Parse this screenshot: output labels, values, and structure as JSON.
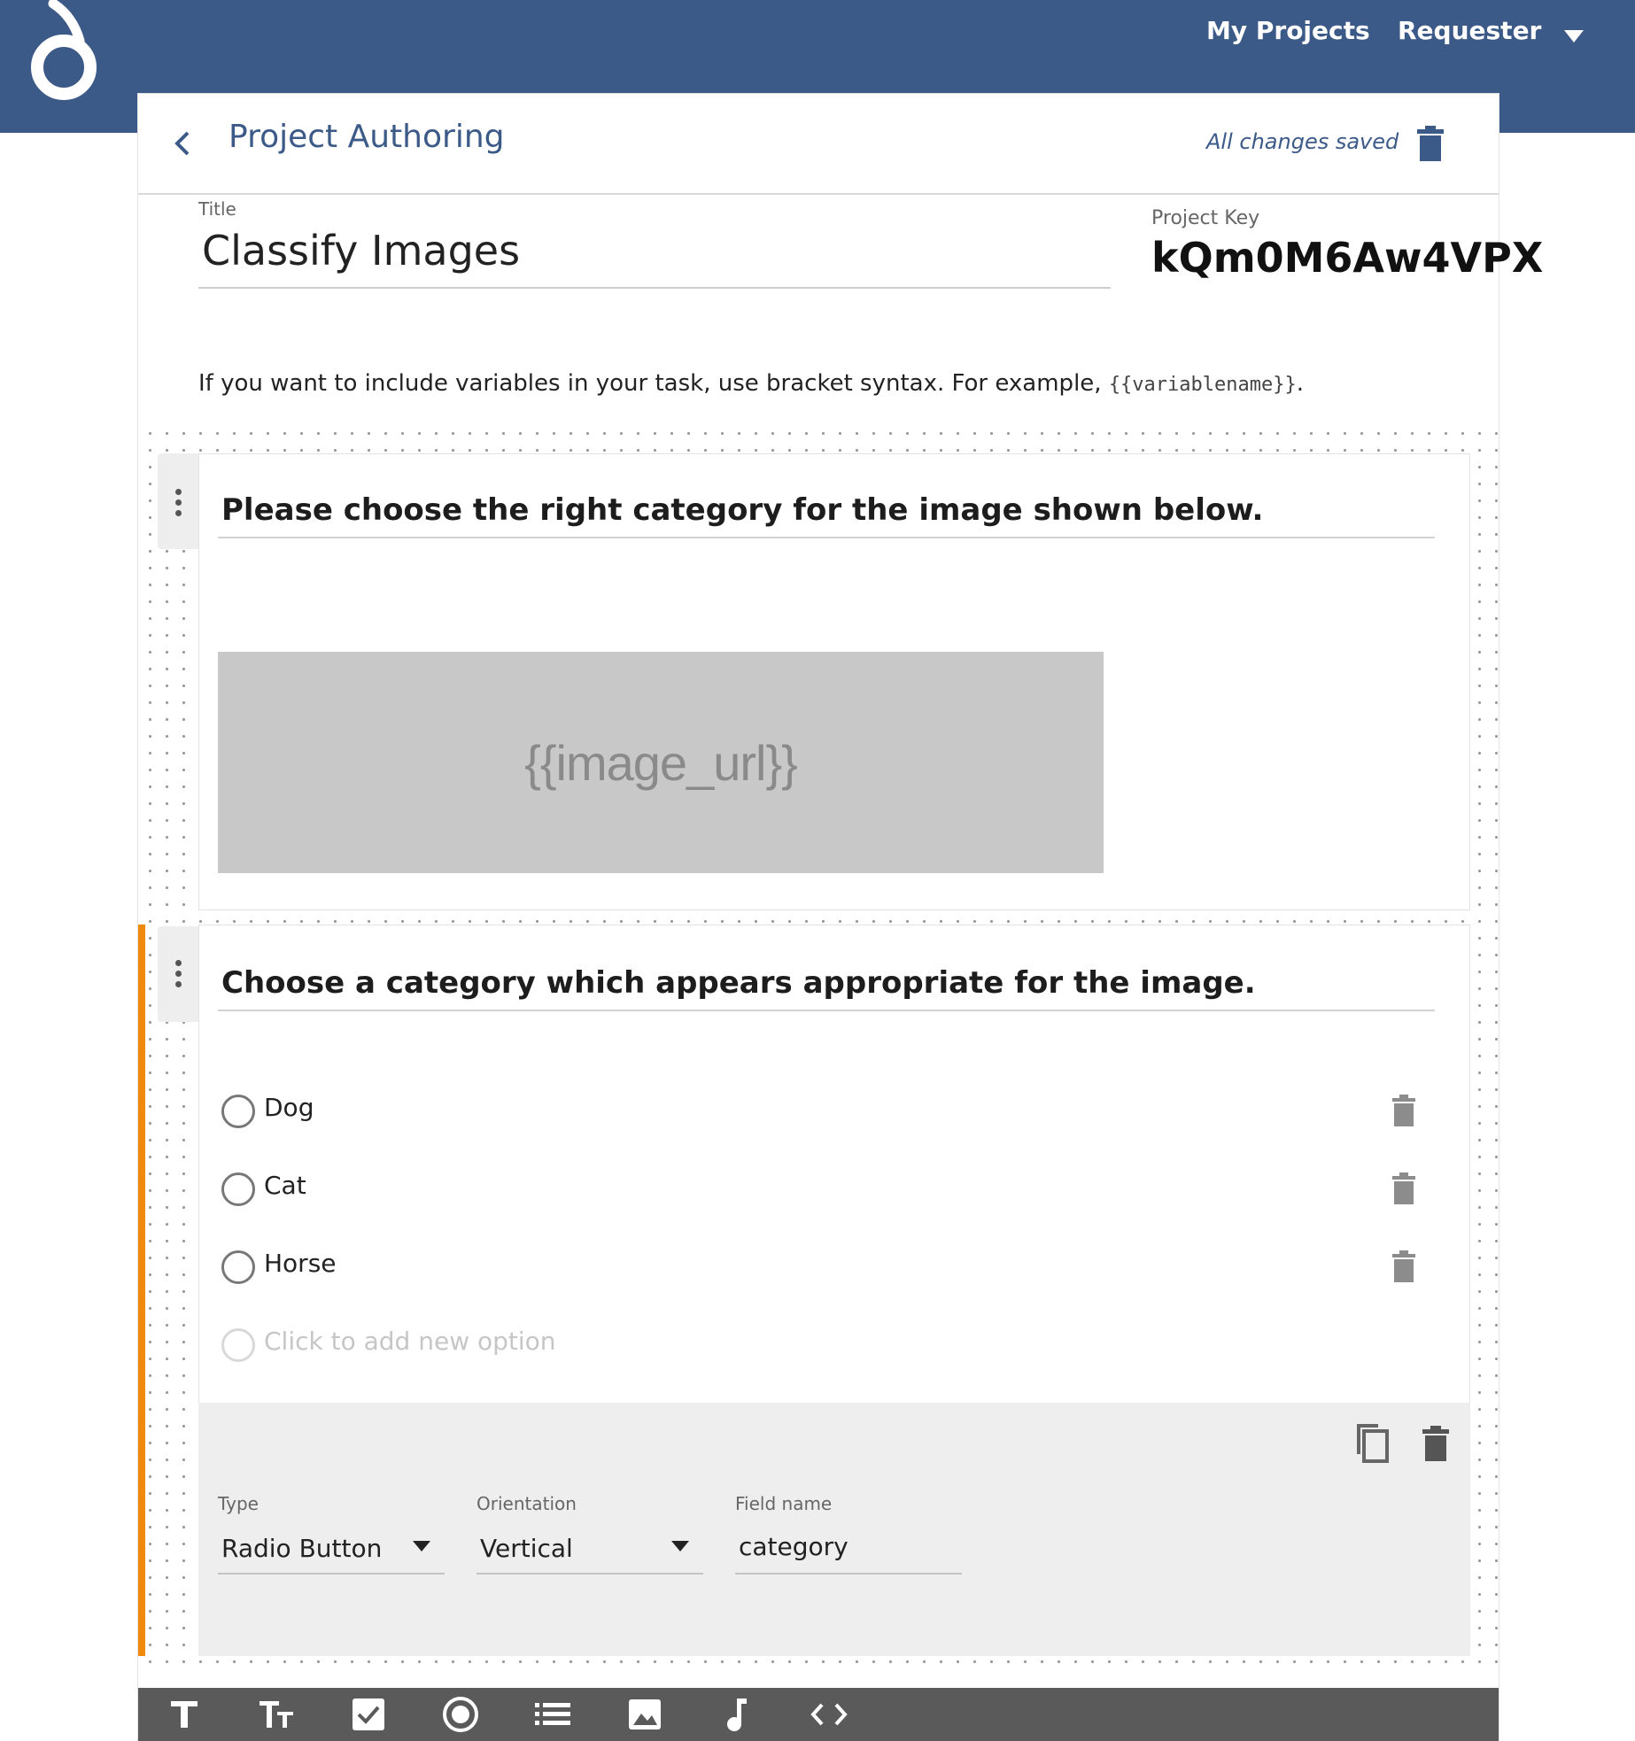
{
  "nav": {
    "links": [
      "My Projects",
      "Requester"
    ]
  },
  "header": {
    "title": "Project Authoring",
    "status": "All changes saved"
  },
  "project": {
    "title_label": "Title",
    "title_value": "Classify Images",
    "key_label": "Project Key",
    "key_value": "kQm0M6Aw4VPX"
  },
  "hint": {
    "text": "If you want to include variables in your task, use bracket syntax. For example, ",
    "code": "{{variablename}}",
    "suffix": "."
  },
  "blocks": [
    {
      "question": "Please choose the right category for the image shown below.",
      "image_placeholder": "{{image_url}}"
    },
    {
      "question": "Choose a category which appears appropriate for the image.",
      "options": [
        "Dog",
        "Cat",
        "Horse"
      ],
      "add_option_placeholder": "Click to add new option",
      "settings": {
        "type_label": "Type",
        "type_value": "Radio Button",
        "orientation_label": "Orientation",
        "orientation_value": "Vertical",
        "field_label": "Field name",
        "field_value": "category"
      }
    }
  ],
  "colors": {
    "brand": "#3c5a88",
    "accent": "#f08a0c",
    "toolbar": "#5a5a5a"
  },
  "toolbar_icons": [
    "text-icon",
    "text-size-icon",
    "checkbox-icon",
    "radio-icon",
    "list-icon",
    "image-icon",
    "audio-icon",
    "code-icon"
  ]
}
